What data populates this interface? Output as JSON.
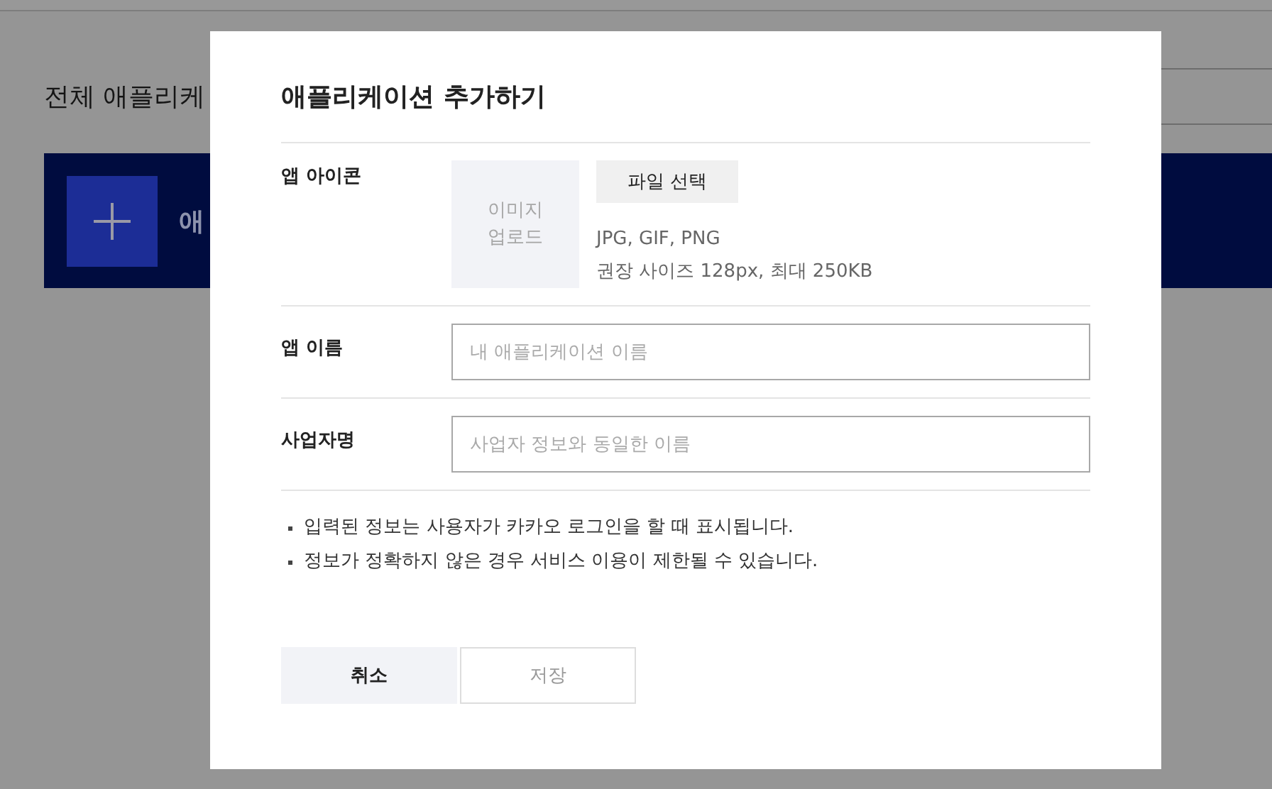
{
  "background": {
    "title": "전체 애플리케",
    "banner": {
      "label": "애"
    }
  },
  "dialog": {
    "title": "애플리케이션 추가하기",
    "fields": [
      {
        "kind": "icon",
        "label": "앱 아이콘",
        "upload_text": "이미지 업로드",
        "button": "파일 선택",
        "hints": [
          "JPG, GIF, PNG",
          "권장 사이즈 128px, 최대 250KB"
        ]
      },
      {
        "kind": "text",
        "label": "앱 이름",
        "placeholder": "내 애플리케이션 이름"
      },
      {
        "kind": "text",
        "label": "사업자명",
        "placeholder": "사업자 정보와 동일한 이름"
      }
    ],
    "notes": [
      "입력된 정보는 사용자가 카카오 로그인을 할 때 표시됩니다.",
      "정보가 정확하지 않은 경우 서비스 이용이 제한될 수 있습니다."
    ],
    "buttons": [
      {
        "label": "취소",
        "disabled": false
      },
      {
        "label": "저장",
        "disabled": true
      }
    ]
  }
}
